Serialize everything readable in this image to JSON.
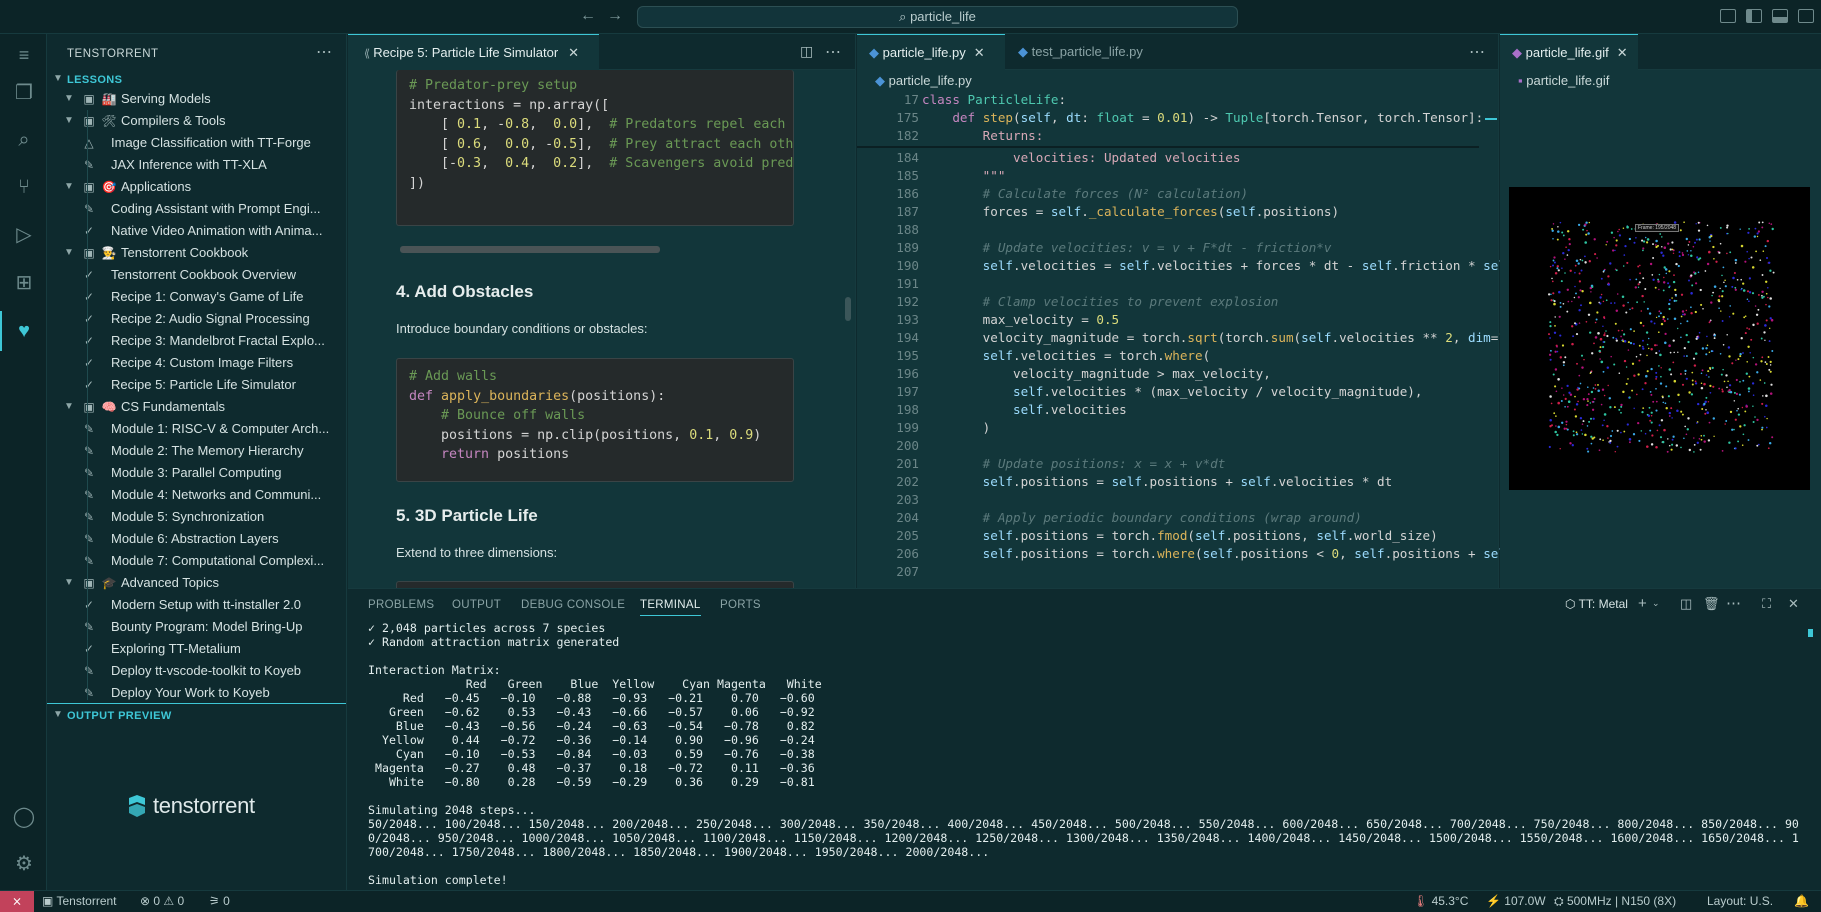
{
  "titlebar": {
    "search": "particle_life"
  },
  "sidebar": {
    "title": "TENSTORRENT",
    "lessons_label": "LESSONS",
    "output_preview_label": "OUTPUT PREVIEW",
    "brand": "tenstorrent",
    "items": [
      {
        "label": "Serving Models",
        "type": "group",
        "emoji": "🏭"
      },
      {
        "label": "Compilers & Tools",
        "type": "group",
        "emoji": "🛠"
      },
      {
        "label": "Image Classification with TT-Forge",
        "type": "warn"
      },
      {
        "label": "JAX Inference with TT-XLA",
        "type": "pencil"
      },
      {
        "label": "Applications",
        "type": "group",
        "emoji": "🎯"
      },
      {
        "label": "Coding Assistant with Prompt Engi...",
        "type": "pencil"
      },
      {
        "label": "Native Video Animation with Anima...",
        "type": "check"
      },
      {
        "label": "Tenstorrent Cookbook",
        "type": "group",
        "emoji": "👨‍🍳"
      },
      {
        "label": "Tenstorrent Cookbook Overview",
        "type": "check"
      },
      {
        "label": "Recipe 1: Conway's Game of Life",
        "type": "check"
      },
      {
        "label": "Recipe 2: Audio Signal Processing",
        "type": "check"
      },
      {
        "label": "Recipe 3: Mandelbrot Fractal Explo...",
        "type": "check"
      },
      {
        "label": "Recipe 4: Custom Image Filters",
        "type": "check"
      },
      {
        "label": "Recipe 5: Particle Life Simulator",
        "type": "check"
      },
      {
        "label": "CS Fundamentals",
        "type": "group",
        "emoji": "🧠"
      },
      {
        "label": "Module 1: RISC-V & Computer Arch...",
        "type": "pencil"
      },
      {
        "label": "Module 2: The Memory Hierarchy",
        "type": "pencil"
      },
      {
        "label": "Module 3: Parallel Computing",
        "type": "pencil"
      },
      {
        "label": "Module 4: Networks and Communi...",
        "type": "pencil"
      },
      {
        "label": "Module 5: Synchronization",
        "type": "pencil"
      },
      {
        "label": "Module 6: Abstraction Layers",
        "type": "pencil"
      },
      {
        "label": "Module 7: Computational Complexi...",
        "type": "pencil"
      },
      {
        "label": "Advanced Topics",
        "type": "group",
        "emoji": "🎓"
      },
      {
        "label": "Modern Setup with tt-installer 2.0",
        "type": "check"
      },
      {
        "label": "Bounty Program: Model Bring-Up",
        "type": "pencil"
      },
      {
        "label": "Exploring TT-Metalium",
        "type": "check"
      },
      {
        "label": "Deploy tt-vscode-toolkit to Koyeb",
        "type": "pencil"
      },
      {
        "label": "Deploy Your Work to Koyeb",
        "type": "pencil"
      }
    ]
  },
  "editor1": {
    "tab": "Recipe 5: Particle Life Simulator",
    "h_obstacles": "4. Add Obstacles",
    "p_obstacles": "Introduce boundary conditions or obstacles:",
    "h_3d": "5. 3D Particle Life",
    "p_3d": "Extend to three dimensions:"
  },
  "editor2": {
    "tab1": "particle_life.py",
    "tab2": "test_particle_life.py",
    "breadcrumb": "particle_life.py"
  },
  "editor3": {
    "tab": "particle_life.gif",
    "breadcrumb": "particle_life.gif",
    "frame_label": "Frame: 195/2048"
  },
  "panel": {
    "tabs": [
      "PROBLEMS",
      "OUTPUT",
      "DEBUG CONSOLE",
      "TERMINAL",
      "PORTS"
    ],
    "terminal_name": "TT: Metal",
    "terminal_lines": [
      "✓ 2,048 particles across 7 species",
      "✓ Random attraction matrix generated",
      "",
      "Interaction Matrix:",
      "              Red   Green    Blue  Yellow    Cyan Magenta   White",
      "     Red   −0.45   −0.10   −0.88   −0.93   −0.21    0.70   −0.60",
      "   Green   −0.62    0.53   −0.43   −0.66   −0.57    0.06   −0.92",
      "    Blue   −0.43   −0.56   −0.24   −0.63   −0.54   −0.78    0.82",
      "  Yellow    0.44   −0.72   −0.36   −0.14    0.90   −0.96   −0.24",
      "    Cyan   −0.10   −0.53   −0.84   −0.03    0.59   −0.76   −0.38",
      " Magenta   −0.27    0.48   −0.37    0.18   −0.72    0.11   −0.36",
      "   White   −0.80    0.28   −0.59   −0.29    0.36    0.29   −0.81",
      "",
      "Simulating 2048 steps...",
      "50/2048... 100/2048... 150/2048... 200/2048... 250/2048... 300/2048... 350/2048... 400/2048... 450/2048... 500/2048... 550/2048... 600/2048... 650/2048... 700/2048... 750/2048... 800/2048... 850/2048... 90",
      "0/2048... 950/2048... 1000/2048... 1050/2048... 1100/2048... 1150/2048... 1200/2048... 1250/2048... 1300/2048... 1350/2048... 1400/2048... 1450/2048... 1500/2048... 1550/2048... 1600/2048... 1650/2048... 1",
      "700/2048... 1750/2048... 1800/2048... 1850/2048... 1900/2048... 1950/2048... 2000/2048...",
      "",
      "Simulation complete!"
    ]
  },
  "statusbar": {
    "profile": "Tenstorrent",
    "errors": "0",
    "warnings": "0",
    "ports": "0",
    "temp": "45.3°C",
    "power": "107.0W",
    "device": "500MHz | N150 (8X)",
    "layout": "Layout: U.S."
  },
  "colors": {
    "accent": "#3ec7d6",
    "background": "#0e2a2e",
    "remote": "#c2425b"
  }
}
